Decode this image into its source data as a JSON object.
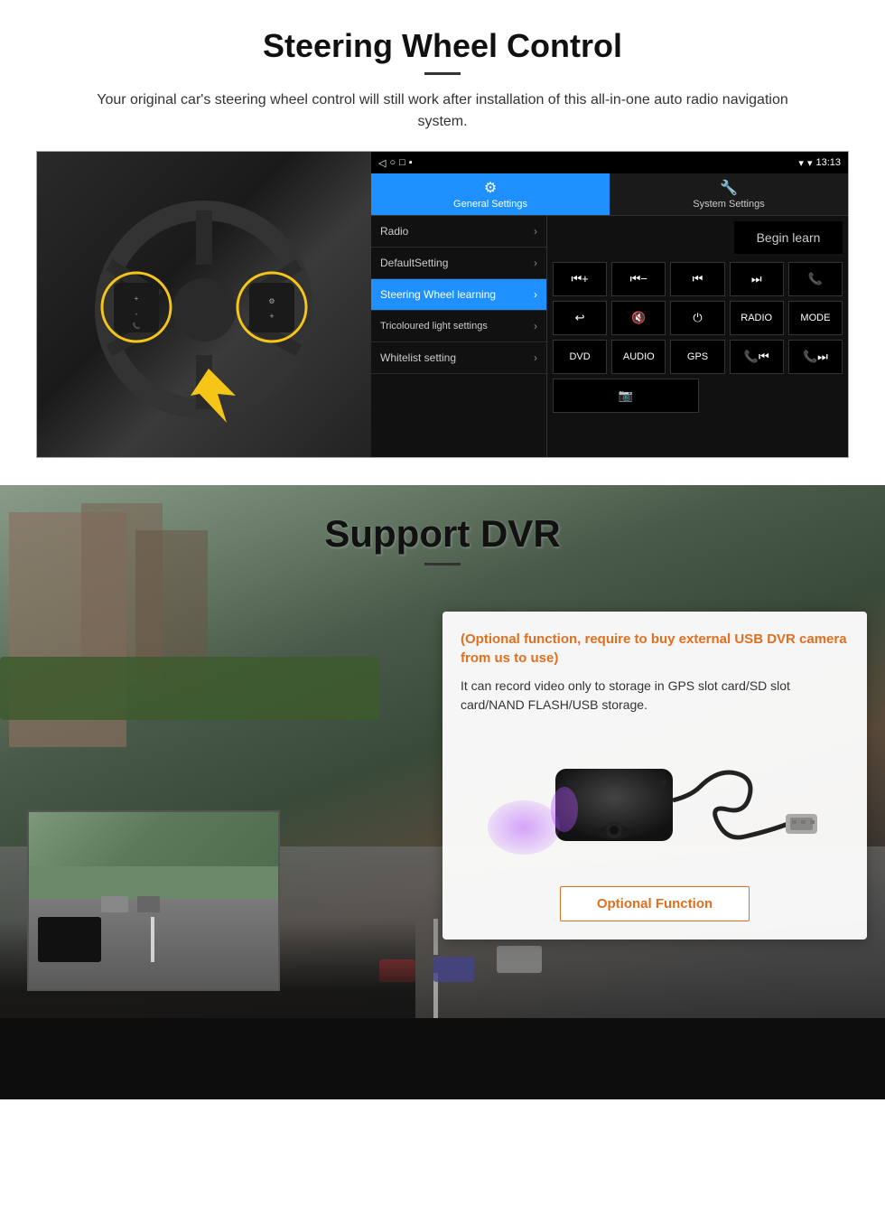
{
  "page": {
    "steering_section": {
      "title": "Steering Wheel Control",
      "description": "Your original car's steering wheel control will still work after installation of this all-in-one auto radio navigation system.",
      "status_bar": {
        "time": "13:13",
        "signal_icon": "▼",
        "wifi_icon": "▼",
        "battery_icon": "▪"
      },
      "tabs": [
        {
          "label": "General Settings",
          "active": true
        },
        {
          "label": "System Settings",
          "active": false
        }
      ],
      "menu_items": [
        {
          "label": "Radio",
          "active": false
        },
        {
          "label": "DefaultSetting",
          "active": false
        },
        {
          "label": "Steering Wheel learning",
          "active": true
        },
        {
          "label": "Tricoloured light settings",
          "active": false
        },
        {
          "label": "Whitelist setting",
          "active": false
        }
      ],
      "begin_learn_label": "Begin learn",
      "control_buttons_row1": [
        "⏮+",
        "⏮-",
        "⏮",
        "⏭",
        "📞"
      ],
      "control_buttons_row2": [
        "↩",
        "🔇",
        "⏻",
        "RADIO",
        "MODE"
      ],
      "control_buttons_row3": [
        "DVD",
        "AUDIO",
        "GPS",
        "📞⏮",
        "📞⏭"
      ],
      "control_buttons_row4": [
        "📷"
      ]
    },
    "dvr_section": {
      "title": "Support DVR",
      "optional_text": "(Optional function, require to buy external USB DVR camera from us to use)",
      "description": "It can record video only to storage in GPS slot card/SD slot card/NAND FLASH/USB storage.",
      "optional_function_label": "Optional Function"
    }
  }
}
